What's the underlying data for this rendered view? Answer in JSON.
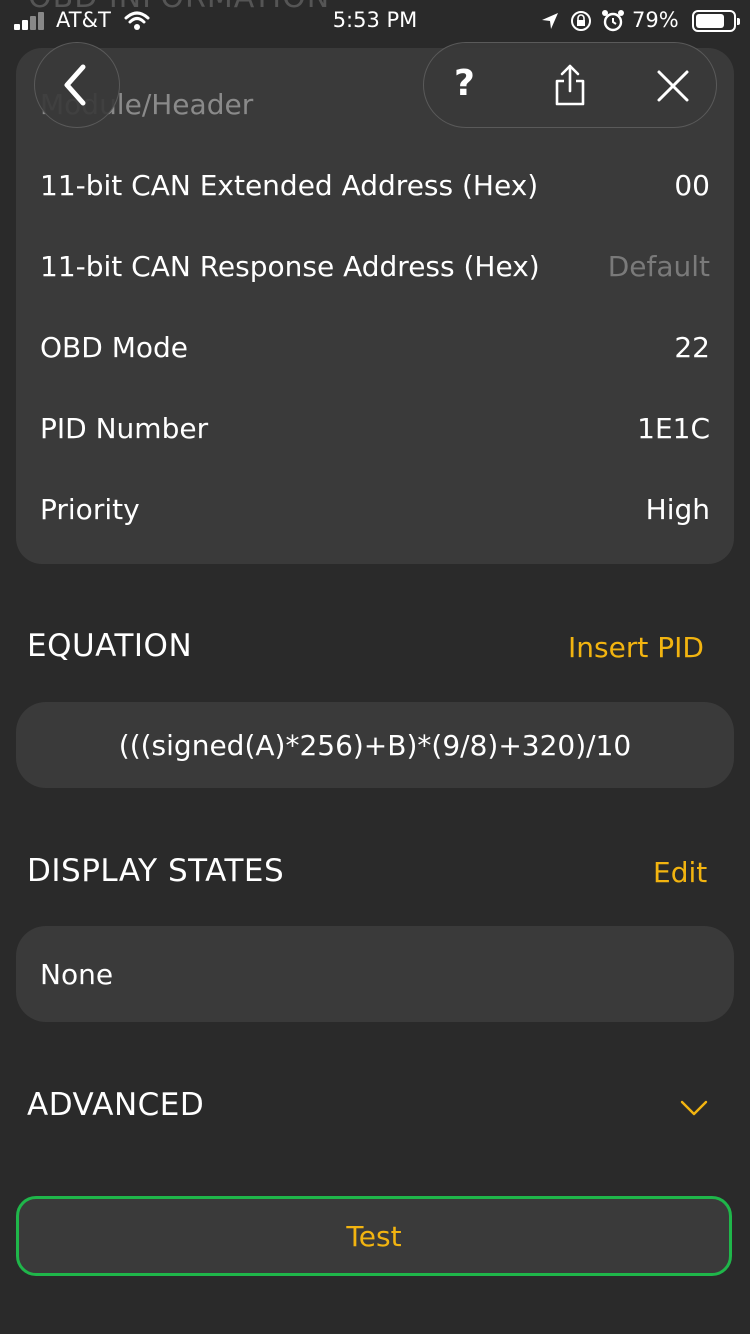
{
  "status_bar": {
    "carrier": "AT&T",
    "time": "5:53 PM",
    "battery_percent": "79%",
    "battery_level": 0.79,
    "icons": [
      "signal-icon",
      "wifi-icon",
      "location-icon",
      "orientation-lock-icon",
      "alarm-icon",
      "battery-icon"
    ]
  },
  "obd_info": {
    "section_title": "OBD INFORMATION",
    "rows": [
      {
        "label": "Module/Header",
        "value": ""
      },
      {
        "label": "11-bit CAN Extended Address (Hex)",
        "value": "00"
      },
      {
        "label": "11-bit CAN Response Address (Hex)",
        "value": "Default"
      },
      {
        "label": "OBD Mode",
        "value": "22"
      },
      {
        "label": "PID Number",
        "value": "1E1C"
      },
      {
        "label": "Priority",
        "value": "High"
      }
    ]
  },
  "nav": {
    "back_icon": "chevron-left-icon",
    "help_label": "?",
    "share_icon": "share-icon",
    "close_icon": "close-icon"
  },
  "equation": {
    "title": "EQUATION",
    "action": "Insert PID",
    "value": "(((signed(A)*256)+B)*(9/8)+320)/10"
  },
  "display_states": {
    "title": "DISPLAY STATES",
    "action": "Edit",
    "value": "None"
  },
  "advanced": {
    "title": "ADVANCED",
    "icon": "chevron-down-icon"
  },
  "test_button": {
    "label": "Test"
  },
  "colors": {
    "background": "#2a2a2a",
    "card": "#3a3a3a",
    "accent": "#f2b410",
    "test_border": "#1fb64a"
  }
}
